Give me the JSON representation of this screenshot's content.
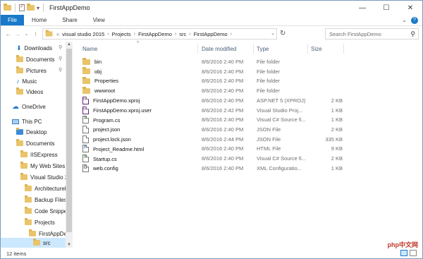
{
  "window": {
    "title": "FirstAppDemo"
  },
  "caption_buttons": {
    "minimize": "—",
    "maximize": "☐",
    "close": "✕"
  },
  "ribbon": {
    "file_tab": "File",
    "tabs": [
      "Home",
      "Share",
      "View"
    ],
    "expand_glyph": "⌄",
    "help_glyph": "?"
  },
  "address_bar": {
    "overflow": "«",
    "crumbs": [
      "visual studio 2015",
      "Projects",
      "FirstAppDemo",
      "src",
      "FirstAppDemo"
    ],
    "separator": "›",
    "dropdown": "⌄",
    "refresh_glyph": "↻"
  },
  "nav_buttons": {
    "back": "←",
    "forward": "→",
    "recent": "⌄",
    "up": "↑"
  },
  "search": {
    "placeholder": "Search FirstAppDemo",
    "icon": "search-icon"
  },
  "navigation_pane": {
    "items": [
      {
        "label": "Downloads",
        "icon": "download-icon",
        "pinned": true
      },
      {
        "label": "Documents",
        "icon": "folder-icon",
        "pinned": true
      },
      {
        "label": "Pictures",
        "icon": "folder-icon",
        "pinned": true
      },
      {
        "label": "Music",
        "icon": "music-icon",
        "pinned": false
      },
      {
        "label": "Videos",
        "icon": "folder-icon",
        "pinned": false
      },
      {
        "label": "OneDrive",
        "icon": "cloud-icon",
        "pinned": false
      },
      {
        "label": "This PC",
        "icon": "computer-icon",
        "pinned": false
      },
      {
        "label": "Desktop",
        "icon": "folder-icon",
        "pinned": false
      },
      {
        "label": "Documents",
        "icon": "folder-icon",
        "pinned": false
      },
      {
        "label": "IISExpress",
        "icon": "folder-icon",
        "pinned": false
      },
      {
        "label": "My Web Sites",
        "icon": "folder-icon",
        "pinned": false
      },
      {
        "label": "Visual Studio 2",
        "icon": "folder-icon",
        "pinned": false
      },
      {
        "label": "ArchitectureE",
        "icon": "folder-icon",
        "pinned": false
      },
      {
        "label": "Backup Files",
        "icon": "folder-icon",
        "pinned": false
      },
      {
        "label": "Code Snippet",
        "icon": "folder-icon",
        "pinned": false
      },
      {
        "label": "Projects",
        "icon": "folder-icon",
        "pinned": false
      },
      {
        "label": "FirstAppDem",
        "icon": "folder-icon",
        "pinned": false
      },
      {
        "label": "src",
        "icon": "folder-icon",
        "pinned": false,
        "selected": true
      }
    ],
    "pin_glyph": "⚲"
  },
  "columns": {
    "name": "Name",
    "date": "Date modified",
    "type": "Type",
    "size": "Size",
    "sort_glyph": "^"
  },
  "files": [
    {
      "name": "bin",
      "date": "8/6/2016 2:40 PM",
      "type": "File folder",
      "size": "",
      "icon": "folder-icon"
    },
    {
      "name": "obj",
      "date": "8/6/2016 2:40 PM",
      "type": "File folder",
      "size": "",
      "icon": "folder-icon"
    },
    {
      "name": "Properties",
      "date": "8/6/2016 2:40 PM",
      "type": "File folder",
      "size": "",
      "icon": "folder-icon"
    },
    {
      "name": "wwwroot",
      "date": "8/6/2016 2:40 PM",
      "type": "File folder",
      "size": "",
      "icon": "folder-icon"
    },
    {
      "name": "FirstAppDemo.xproj",
      "date": "8/6/2016 2:40 PM",
      "type": "ASP.NET 5 (XPROJ)",
      "size": "2 KB",
      "icon": "vs-project-icon"
    },
    {
      "name": "FirstAppDemo.xproj.user",
      "date": "8/6/2016 2:42 PM",
      "type": "Visual Studio Proj...",
      "size": "1 KB",
      "icon": "vs-user-icon"
    },
    {
      "name": "Program.cs",
      "date": "8/6/2016 2:40 PM",
      "type": "Visual C# Source fi...",
      "size": "1 KB",
      "icon": "csharp-file-icon"
    },
    {
      "name": "project.json",
      "date": "8/6/2016 2:40 PM",
      "type": "JSON File",
      "size": "2 KB",
      "icon": "json-file-icon"
    },
    {
      "name": "project.lock.json",
      "date": "8/6/2016 2:44 PM",
      "type": "JSON File",
      "size": "335 KB",
      "icon": "json-file-icon"
    },
    {
      "name": "Project_Readme.html",
      "date": "8/6/2016 2:40 PM",
      "type": "HTML File",
      "size": "9 KB",
      "icon": "html-file-icon"
    },
    {
      "name": "Startup.cs",
      "date": "8/6/2016 2:40 PM",
      "type": "Visual C# Source fi...",
      "size": "2 KB",
      "icon": "csharp-file-icon"
    },
    {
      "name": "web.config",
      "date": "8/6/2016 2:40 PM",
      "type": "XML Configuratio...",
      "size": "1 KB",
      "icon": "config-file-icon"
    }
  ],
  "status": {
    "item_count": "12 items"
  },
  "watermark": "php中文网",
  "colors": {
    "accent": "#1979ca",
    "folder": "#e9c46a",
    "selection": "#cce8ff"
  }
}
